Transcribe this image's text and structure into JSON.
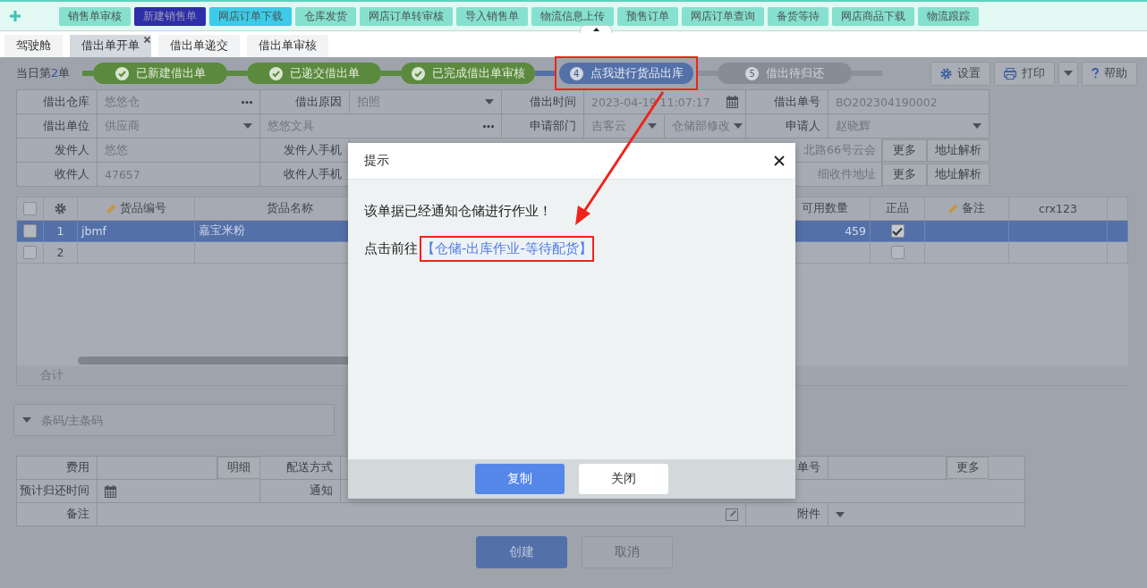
{
  "nav_bar": {
    "buttons": [
      {
        "label": "销售单审核",
        "color": "#86e0cf"
      },
      {
        "label": "新建销售单",
        "color": "#2e2ea8"
      },
      {
        "label": "网店订单下载",
        "color": "#3ccbe8"
      },
      {
        "label": "仓库发货",
        "color": "#86e0cf"
      },
      {
        "label": "网店订单转审核",
        "color": "#86e0cf"
      },
      {
        "label": "导入销售单",
        "color": "#86e0cf"
      },
      {
        "label": "物流信息上传",
        "color": "#86e0cf"
      },
      {
        "label": "预售订单",
        "color": "#86e0cf"
      },
      {
        "label": "网店订单查询",
        "color": "#86e0cf"
      },
      {
        "label": "备货等待",
        "color": "#86e0cf"
      },
      {
        "label": "网店商品下载",
        "color": "#86e0cf"
      },
      {
        "label": "物流跟踪",
        "color": "#86e0cf"
      }
    ]
  },
  "tabs": [
    {
      "label": "驾驶舱",
      "selected": false,
      "closable": false
    },
    {
      "label": "借出单开单",
      "selected": true,
      "closable": true
    },
    {
      "label": "借出单递交",
      "selected": false,
      "closable": false
    },
    {
      "label": "借出单审核",
      "selected": false,
      "closable": false
    }
  ],
  "progress": {
    "daily_count": {
      "prefix": "当日第",
      "number": "2",
      "suffix": "单"
    },
    "steps": [
      {
        "label": "已新建借出单",
        "kind": "done",
        "annotated": false
      },
      {
        "label": "已递交借出单",
        "kind": "done",
        "annotated": false
      },
      {
        "label": "已完成借出单审核",
        "kind": "done",
        "annotated": false
      },
      {
        "number": "4",
        "label": "点我进行货品出库",
        "kind": "current",
        "annotated": true
      },
      {
        "number": "5",
        "label": "借出待归还",
        "kind": "pending",
        "annotated": false
      }
    ]
  },
  "toolbar": [
    {
      "label": "设置",
      "kind": "settings"
    },
    {
      "label": "打印",
      "kind": "print"
    },
    {
      "label": "帮助",
      "kind": "help"
    }
  ],
  "order_form": {
    "rows": [
      [
        {
          "kind": "label",
          "text": "借出仓库"
        },
        {
          "kind": "lookup",
          "value": "悠悠仓"
        },
        {
          "kind": "label",
          "text": "借出原因"
        },
        {
          "kind": "select",
          "value": "拍照"
        },
        {
          "kind": "label",
          "text": "借出时间"
        },
        {
          "kind": "date",
          "value": "2023-04-19 11:07:17"
        },
        "",
        {
          "kind": "label",
          "text": "借出单号"
        },
        {
          "kind": "text",
          "value": "BO202304190002"
        },
        "",
        ""
      ],
      [
        {
          "kind": "label",
          "text": "借出单位"
        },
        {
          "kind": "select",
          "value": "供应商"
        },
        {
          "kind": "lookup",
          "value": "悠悠文具"
        },
        "",
        {
          "kind": "label",
          "text": "申请部门"
        },
        {
          "kind": "select",
          "value": "吉客云"
        },
        {
          "kind": "select",
          "value": "仓储部修改"
        },
        {
          "kind": "label",
          "text": "申请人"
        },
        {
          "kind": "select",
          "value": "赵晓辉"
        },
        "",
        ""
      ],
      [
        {
          "kind": "label",
          "text": "发件人"
        },
        {
          "kind": "text",
          "value": "悠悠"
        },
        {
          "kind": "label",
          "text": "发件人手机"
        },
        {
          "kind": "address",
          "value": "北路66号云会"
        },
        "",
        "",
        "",
        "",
        "",
        {
          "kind": "button",
          "text": "更多"
        },
        {
          "kind": "button",
          "text": "地址解析"
        }
      ],
      [
        {
          "kind": "label",
          "text": "收件人"
        },
        {
          "kind": "text",
          "value": "47657"
        },
        {
          "kind": "label",
          "text": "收件人手机"
        },
        {
          "kind": "address",
          "value": "细收件地址"
        },
        "",
        "",
        "",
        "",
        "",
        {
          "kind": "button",
          "text": "更多"
        },
        {
          "kind": "button",
          "text": "地址解析"
        }
      ]
    ]
  },
  "items_table": {
    "columns": [
      {
        "kind": "select",
        "checked": false
      },
      {
        "kind": "settings"
      },
      {
        "kind": "code",
        "label": "货品编号",
        "editable": true
      },
      {
        "kind": "name",
        "label": "货品名称",
        "editable": false
      },
      {
        "kind": "blank"
      },
      {
        "kind": "qty",
        "label": "可用数量",
        "editable": false
      },
      {
        "kind": "genuine",
        "label": "正品",
        "editable": false
      },
      {
        "kind": "remark",
        "label": "备注",
        "editable": true
      },
      {
        "kind": "custom",
        "label": "crx123",
        "editable": false
      },
      {
        "kind": "blank"
      }
    ],
    "rows": [
      {
        "selected": true,
        "checked": false,
        "row_number": "1",
        "item_code": "jbmf",
        "item_name": "嘉宝米粉",
        "available_qty": "459",
        "genuine": true
      },
      {
        "selected": false,
        "checked": false,
        "row_number": "2",
        "genuine": false
      }
    ],
    "totals": {
      "label": "合计"
    }
  },
  "barcode": {
    "placeholder": "条码/主条码"
  },
  "extra_form": {
    "rows": [
      [
        {
          "kind": "label",
          "text": "费用"
        },
        {
          "kind": "text"
        },
        {
          "kind": "button",
          "text": "明细"
        },
        {
          "kind": "label",
          "text": "配送方式"
        },
        {
          "kind": "blank"
        },
        {
          "kind": "label",
          "text": "单号"
        },
        {
          "kind": "text"
        },
        {
          "kind": "button",
          "text": "更多"
        },
        {
          "kind": "blank"
        }
      ],
      [
        {
          "kind": "label",
          "text": "预计归还时间"
        },
        {
          "kind": "date"
        },
        "",
        {
          "kind": "label",
          "text": "通知"
        },
        {
          "kind": "blank"
        },
        "",
        "",
        "",
        ""
      ],
      [
        {
          "kind": "label",
          "text": "备注"
        },
        {
          "kind": "memo"
        },
        "",
        "",
        "",
        {
          "kind": "label",
          "text": "附件"
        },
        {
          "kind": "select"
        },
        "",
        ""
      ]
    ]
  },
  "actions": [
    {
      "label": "创建",
      "kind": "primary"
    },
    {
      "label": "取消",
      "kind": "disabled"
    }
  ],
  "dialog": {
    "title": "提示",
    "message": "该单据已经通知仓储进行作业！",
    "link_prefix": "点击前往",
    "link": "【仓储-出库作业-等待配货】",
    "link_annotated": true,
    "buttons": [
      {
        "label": "复制",
        "kind": "primary"
      },
      {
        "label": "关闭",
        "kind": "secondary"
      }
    ]
  }
}
